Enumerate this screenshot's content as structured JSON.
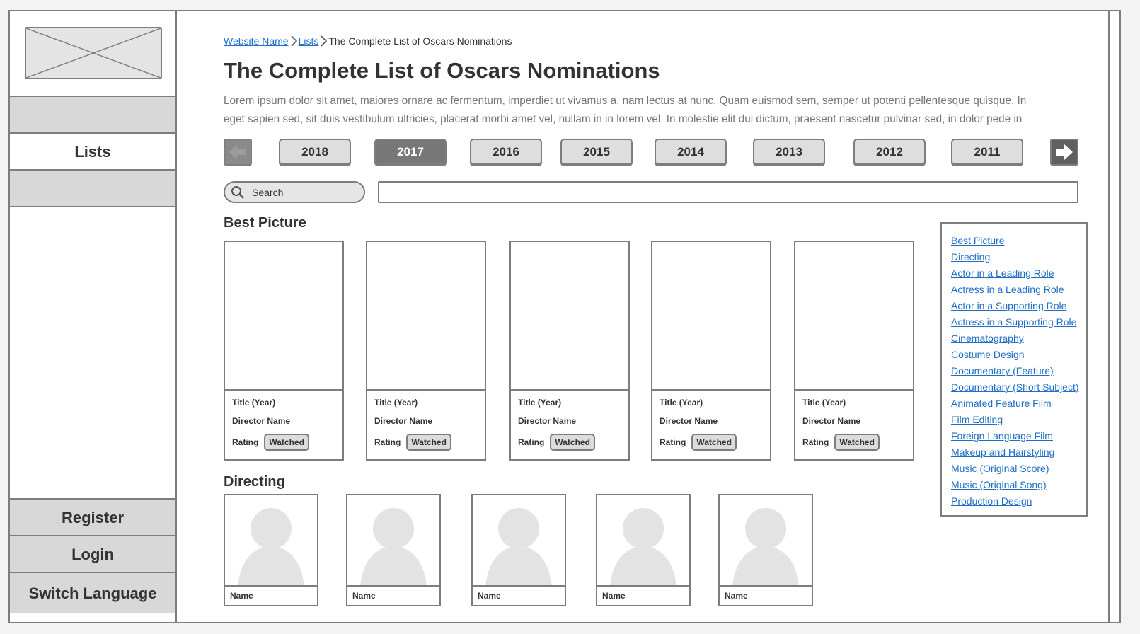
{
  "sidebar": {
    "nav": [
      {
        "label": ""
      },
      {
        "label": "Lists",
        "active": true
      },
      {
        "label": ""
      }
    ],
    "bottom": [
      {
        "label": "Register"
      },
      {
        "label": "Login"
      },
      {
        "label": "Switch Language"
      }
    ]
  },
  "breadcrumb": {
    "home": "Website Name",
    "section": "Lists",
    "current": "The Complete List of Oscars Nominations"
  },
  "page": {
    "title": "The Complete List of Oscars Nominations",
    "intro_line1": "Lorem ipsum dolor sit amet, maiores ornare ac fermentum, imperdiet ut vivamus a, nam lectus at nunc. Quam euismod sem, semper ut potenti pellentesque quisque. In",
    "intro_line2": "eget sapien sed, sit duis vestibulum ultricies, placerat morbi amet vel, nullam in in lorem vel. In molestie elit dui dictum, praesent nascetur pulvinar sed, in dolor pede in"
  },
  "years": {
    "selected": "2017",
    "items": [
      "2018",
      "2017",
      "2016",
      "2015",
      "2014",
      "2013",
      "2012",
      "2011"
    ]
  },
  "search": {
    "label": "Search",
    "value": ""
  },
  "best_picture": {
    "heading": "Best Picture",
    "cards": [
      {
        "title": "Title (Year)",
        "director": "Director Name",
        "rating": "Rating",
        "watched": "Watched"
      },
      {
        "title": "Title (Year)",
        "director": "Director Name",
        "rating": "Rating",
        "watched": "Watched"
      },
      {
        "title": "Title (Year)",
        "director": "Director Name",
        "rating": "Rating",
        "watched": "Watched"
      },
      {
        "title": "Title (Year)",
        "director": "Director Name",
        "rating": "Rating",
        "watched": "Watched"
      },
      {
        "title": "Title (Year)",
        "director": "Director Name",
        "rating": "Rating",
        "watched": "Watched"
      }
    ]
  },
  "directing": {
    "heading": "Directing",
    "people": [
      {
        "name": "Name"
      },
      {
        "name": "Name"
      },
      {
        "name": "Name"
      },
      {
        "name": "Name"
      },
      {
        "name": "Name"
      }
    ]
  },
  "categories": [
    "Best Picture",
    "Directing",
    "Actor in a Leading Role",
    "Actress in a Leading Role",
    "Actor in a Supporting Role",
    "Actress in a Supporting Role",
    "Cinematography",
    "Costume Design",
    "Documentary (Feature)",
    "Documentary (Short Subject)",
    "Animated Feature Film",
    "Film Editing",
    "Foreign Language Film",
    "Makeup and Hairstyling",
    "Music (Original Score)",
    "Music (Original Song)",
    "Production Design"
  ],
  "colors": {
    "link": "#1f6fc6",
    "border": "#7d7d7d",
    "selected_year": "#777777",
    "sidebar_fill": "#d8d8d8"
  }
}
